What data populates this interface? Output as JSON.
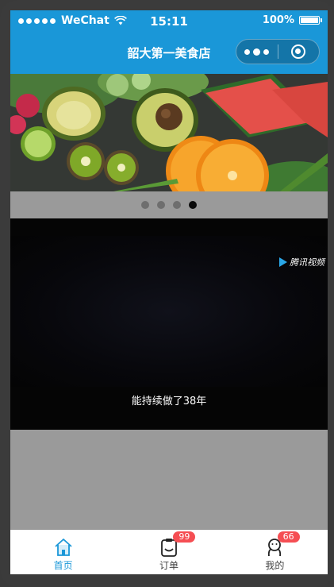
{
  "status_bar": {
    "carrier": "WeChat",
    "time": "15:11",
    "battery": "100%"
  },
  "nav": {
    "title": "韶大第一美食店"
  },
  "banner": {
    "image_description_icon": "fruit-banner-image",
    "page_count": 4,
    "active_index": 3
  },
  "video": {
    "provider_label": "腾讯视频",
    "caption": "能持续做了38年"
  },
  "tabbar": {
    "items": [
      {
        "label": "首页",
        "icon": "home-icon",
        "badge": "",
        "active": true
      },
      {
        "label": "订单",
        "icon": "orders-icon",
        "badge": "99",
        "active": false
      },
      {
        "label": "我的",
        "icon": "profile-icon",
        "badge": "66",
        "active": false
      }
    ]
  },
  "colors": {
    "primary": "#1a97d8",
    "badge": "#f54e53",
    "page_bg": "#9a9a9a"
  }
}
